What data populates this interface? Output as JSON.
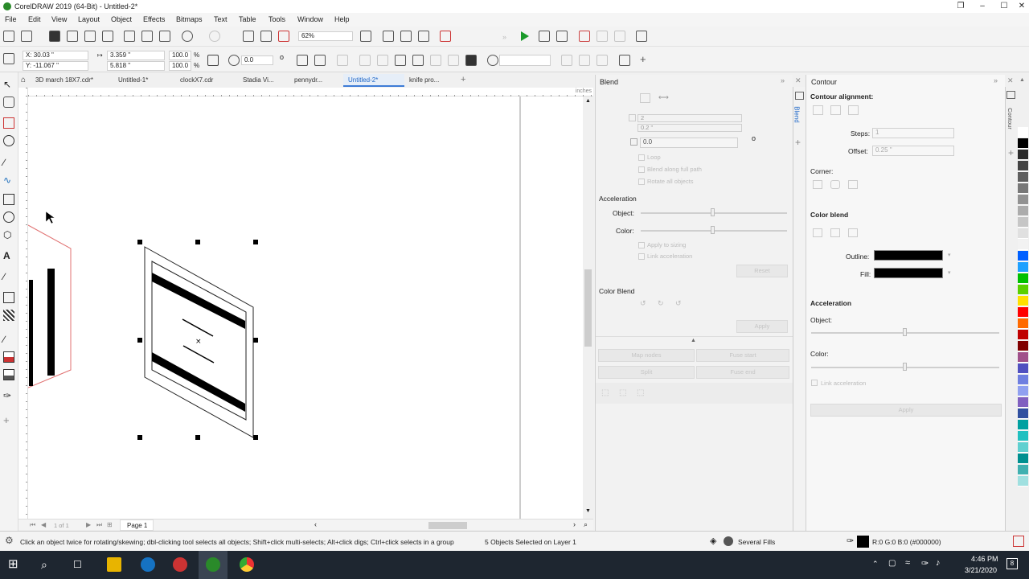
{
  "window": {
    "title": "CorelDRAW 2019 (64-Bit) - Untitled-2*"
  },
  "menu": [
    "File",
    "Edit",
    "View",
    "Layout",
    "Object",
    "Effects",
    "Bitmaps",
    "Text",
    "Table",
    "Tools",
    "Window",
    "Help"
  ],
  "toolbar": {
    "zoom": "62%"
  },
  "propbar": {
    "x": "X: 30.03 \"",
    "y": "Y: -11.067 \"",
    "w": "3.359 \"",
    "h": "5.818 \"",
    "sx": "100.0",
    "sy": "100.0",
    "pct": "%",
    "rotation": "0.0",
    "deg": "o"
  },
  "tabs": [
    "3D march 18X7.cdr*",
    "Untitled-1*",
    "clockX7.cdr",
    "Stadia Vi...",
    "pennydr...",
    "Untitled-2*",
    "knife pro..."
  ],
  "ruler": {
    "units": "inches"
  },
  "page_nav": {
    "of": "1 of 1",
    "page_label": "Page 1"
  },
  "blend": {
    "title": "Blend",
    "steps": "2",
    "spacing": "0.2 \"",
    "rotation": "0.0",
    "rotation_unit": "o",
    "loop": "Loop",
    "blend_along_path": "Blend along full path",
    "rotate_all": "Rotate all objects",
    "acceleration": "Acceleration",
    "object": "Object:",
    "color": "Color:",
    "apply_to_sizing": "Apply to sizing",
    "link_acceleration": "Link acceleration",
    "reset": "Reset",
    "color_blend": "Color Blend",
    "apply": "Apply",
    "map_nodes": "Map nodes",
    "fuse_start": "Fuse start",
    "split": "Split",
    "fuse_end": "Fuse end",
    "side_tab": "Blend"
  },
  "contour": {
    "title": "Contour",
    "alignment": "Contour alignment:",
    "steps_label": "Steps:",
    "steps": "1",
    "offset_label": "Offset:",
    "offset": "0.25 \"",
    "corner": "Corner:",
    "color_blend": "Color blend",
    "outline": "Outline:",
    "fill": "Fill:",
    "acceleration": "Acceleration",
    "object": "Object:",
    "color": "Color:",
    "link_acceleration": "Link acceleration",
    "apply": "Apply",
    "side_tab": "Contour"
  },
  "palette_colors": [
    "#ffffff",
    "#000000",
    "#2b2b2b",
    "#444444",
    "#5e5e5e",
    "#787878",
    "#929292",
    "#acacac",
    "#c6c6c6",
    "#e0e0e0",
    "#f2f2f2",
    "#0060ff",
    "#1ea0ff",
    "#00c000",
    "#5ad000",
    "#ffe000",
    "#ff0000",
    "#ff6a00",
    "#c00000",
    "#800000",
    "#a0508a",
    "#5050c0",
    "#6f7fe0",
    "#90a0f0",
    "#8060c0",
    "#3050a0",
    "#00a0a0",
    "#20c0c0",
    "#60d0d0",
    "#009090",
    "#40b0b0",
    "#a0e0e0"
  ],
  "status": {
    "hint": "Click an object twice for rotating/skewing; dbl-clicking tool selects all objects; Shift+click multi-selects; Alt+click digs; Ctrl+click selects in a group",
    "selection": "5 Objects Selected on Layer 1",
    "fills": "Several Fills",
    "color": "R:0 G:0 B:0 (#000000)"
  },
  "taskbar": {
    "time": "4:46 PM",
    "date": "3/21/2020",
    "notif": "8"
  }
}
